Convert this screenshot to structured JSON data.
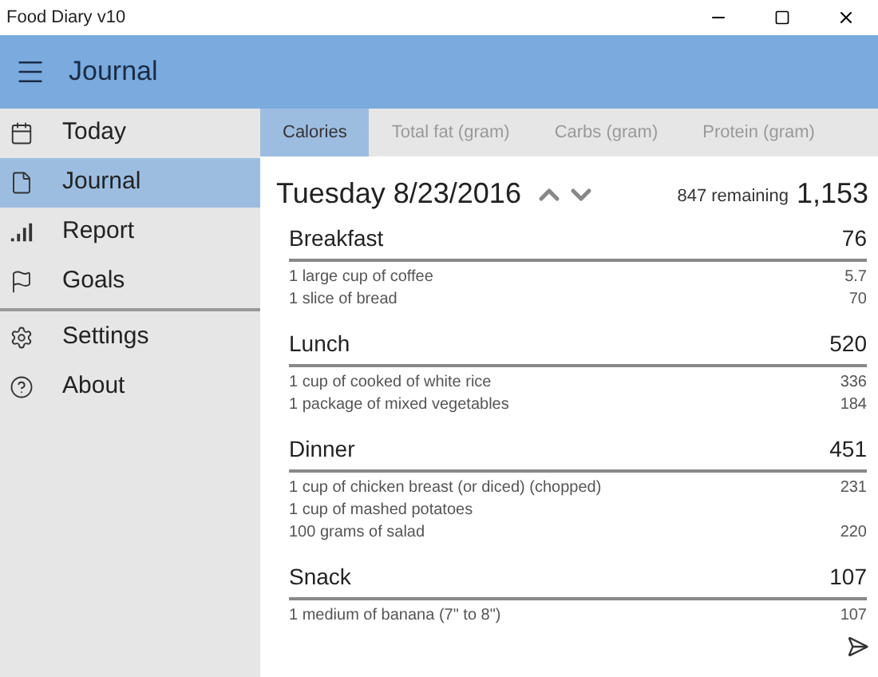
{
  "window": {
    "title": "Food Diary v10"
  },
  "header": {
    "title": "Journal"
  },
  "nav": {
    "main": [
      {
        "kind": "calendar",
        "label": "Today",
        "selected": false
      },
      {
        "kind": "page",
        "label": "Journal",
        "selected": true
      },
      {
        "kind": "chart",
        "label": "Report",
        "selected": false
      },
      {
        "kind": "flag",
        "label": "Goals",
        "selected": false
      }
    ],
    "bottom": [
      {
        "kind": "gear",
        "label": "Settings",
        "selected": false
      },
      {
        "kind": "help",
        "label": "About",
        "selected": false
      }
    ]
  },
  "tabs": [
    {
      "label": "Calories",
      "selected": true
    },
    {
      "label": "Total fat (gram)",
      "selected": false
    },
    {
      "label": "Carbs (gram)",
      "selected": false
    },
    {
      "label": "Protein (gram)",
      "selected": false
    }
  ],
  "day": {
    "date": "Tuesday 8/23/2016",
    "remaining": "847 remaining",
    "total": "1,153"
  },
  "meals": [
    {
      "name": "Breakfast",
      "total": "76",
      "items": [
        {
          "food": "1 large cup of coffee",
          "value": "5.7"
        },
        {
          "food": "1 slice of bread",
          "value": "70"
        }
      ]
    },
    {
      "name": "Lunch",
      "total": "520",
      "items": [
        {
          "food": "1 cup of cooked of white rice",
          "value": "336"
        },
        {
          "food": "1 package of mixed vegetables",
          "value": "184"
        }
      ]
    },
    {
      "name": "Dinner",
      "total": "451",
      "items": [
        {
          "food": "1 cup of chicken breast (or diced) (chopped)",
          "value": "231"
        },
        {
          "food": "1 cup of mashed potatoes"
        },
        {
          "food": "100 grams of salad",
          "value": "220"
        }
      ]
    },
    {
      "name": "Snack",
      "total": "107",
      "items": [
        {
          "food": "1 medium of banana (7\" to 8\")",
          "value": "107"
        }
      ]
    }
  ]
}
